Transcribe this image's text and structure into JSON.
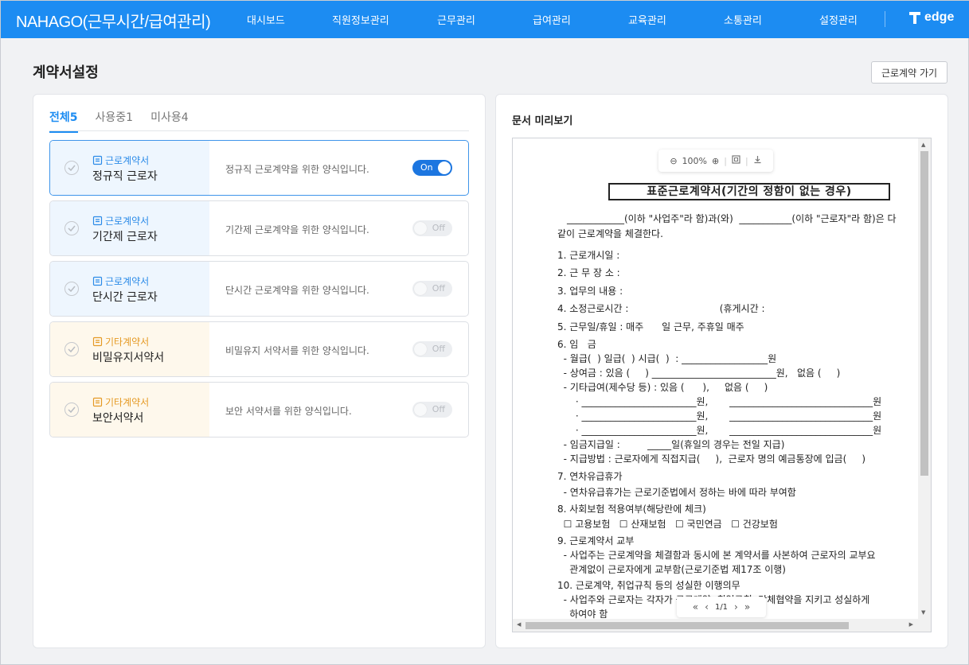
{
  "header": {
    "brand": "NAHAGO(근무시간/급여관리)",
    "nav": [
      "대시보드",
      "직원정보관리",
      "근무관리",
      "급여관리",
      "교육관리",
      "소통관리",
      "설정관리"
    ],
    "logo_text": "edge"
  },
  "page": {
    "title": "계약서설정",
    "goto_button": "근로계약 가기"
  },
  "tabs": [
    {
      "label": "전체",
      "count": "5"
    },
    {
      "label": "사용중",
      "count": "1"
    },
    {
      "label": "미사용",
      "count": "4"
    }
  ],
  "templates": [
    {
      "category": "근로계약서",
      "name": "정규직 근로자",
      "description": "정규직 근로계약을 위한 양식입니다.",
      "toggle": "On",
      "color": "#2b8be8"
    },
    {
      "category": "근로계약서",
      "name": "기간제 근로자",
      "description": "기간제 근로계약을 위한 양식입니다.",
      "toggle": "Off",
      "color": "#2b8be8"
    },
    {
      "category": "근로계약서",
      "name": "단시간 근로자",
      "description": "단시간 근로계약을 위한 양식입니다.",
      "toggle": "Off",
      "color": "#2b8be8"
    },
    {
      "category": "기타계약서",
      "name": "비밀유지서약서",
      "description": "비밀유지 서약서를 위한 양식입니다.",
      "toggle": "Off",
      "color": "#e59a25"
    },
    {
      "category": "기타계약서",
      "name": "보안서약서",
      "description": "보안 서약서를 위한 양식입니다.",
      "toggle": "Off",
      "color": "#e59a25"
    }
  ],
  "preview": {
    "title": "문서 미리보기",
    "zoom": "100%",
    "page_indicator": "1/1",
    "doc_title": "표준근로계약서(기간의 정함이 없는 경우)",
    "lines": [
      "____________(이하 \"사업주\"라 함)과(와)  ___________(이하 \"근로자\"라 함)은 다",
      "같이 근로계약을 체결한다.",
      "1. 근로개시일 :",
      "2. 근 무 장 소 :",
      "3. 업무의 내용 :",
      "4. 소정근로시간 :                              (휴게시간 :",
      "5. 근무일/휴일 : 매주      일 근무, 주휴일 매주",
      "6. 임   금",
      "  - 월급(  ) 일급(  ) 시급(  )  : __________________원",
      "  - 상여금 : 있음 (     ) __________________________원,   없음 (     )",
      "  - 기타급여(제수당 등) : 있음 (      ),     없음 (     )",
      "      · ________________________원,       ______________________________원",
      "      · ________________________원,       ______________________________원",
      "      · ________________________원,       ______________________________원",
      "  - 임금지급일 :         _____일(휴일의 경우는 전일 지급)",
      "  - 지급방법 : 근로자에게 직접지급(     ),  근로자 명의 예금통장에 입금(     )",
      "7. 연차유급휴가",
      "  - 연차유급휴가는 근로기준법에서 정하는 바에 따라 부여함",
      "8. 사회보험 적용여부(해당란에 체크)",
      "  ☐ 고용보험   ☐ 산재보험   ☐ 국민연금   ☐ 건강보험",
      "9. 근로계약서 교부",
      "  - 사업주는 근로계약을 체결함과 동시에 본 계약서를 사본하여 근로자의 교부요",
      "    관계없이 근로자에게 교부함(근로기준법 제17조 이행)",
      "10. 근로계약, 취업규칙 등의 성실한 이행의무",
      "  - 사업주와 근로자는 각자가 근로계약, 취업규칙, 단체협약을 지키고 성실하게",
      "    하여야 함"
    ]
  }
}
